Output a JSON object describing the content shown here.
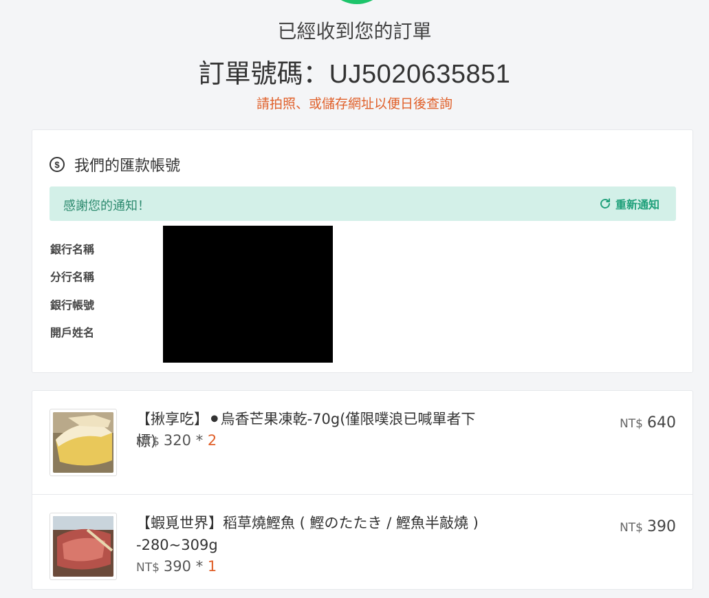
{
  "header": {
    "received": "已經收到您的訂單",
    "order_label": "訂單號碼：",
    "order_number": "UJ5020635851",
    "hint": "請拍照、或儲存網址以便日後查詢"
  },
  "bank": {
    "title": "我們的匯款帳號",
    "notice": "感謝您的通知！",
    "renotify": "重新通知",
    "labels": [
      "銀行名稱",
      "分行名稱",
      "銀行帳號",
      "開戶姓名"
    ]
  },
  "items": [
    {
      "name": "【揪享吃】⚫烏香芒果凍乾-70g(僅限噗浪已喊單者下標)",
      "currency": "NT$",
      "unit_price": "320",
      "times": "*",
      "qty": "2",
      "total": "640"
    },
    {
      "name": "【蝦覓世界】稻草燒鰹魚 ( 鰹のたたき / 鰹魚半敲燒 ) -280~309g",
      "currency": "NT$",
      "unit_price": "390",
      "times": "*",
      "qty": "1",
      "total": "390"
    }
  ],
  "colors": {
    "accent_green": "#1fa07a",
    "success_circle": "#1dc46b",
    "warning_orange": "#e0602a",
    "notice_bg": "#d3f0e8"
  }
}
